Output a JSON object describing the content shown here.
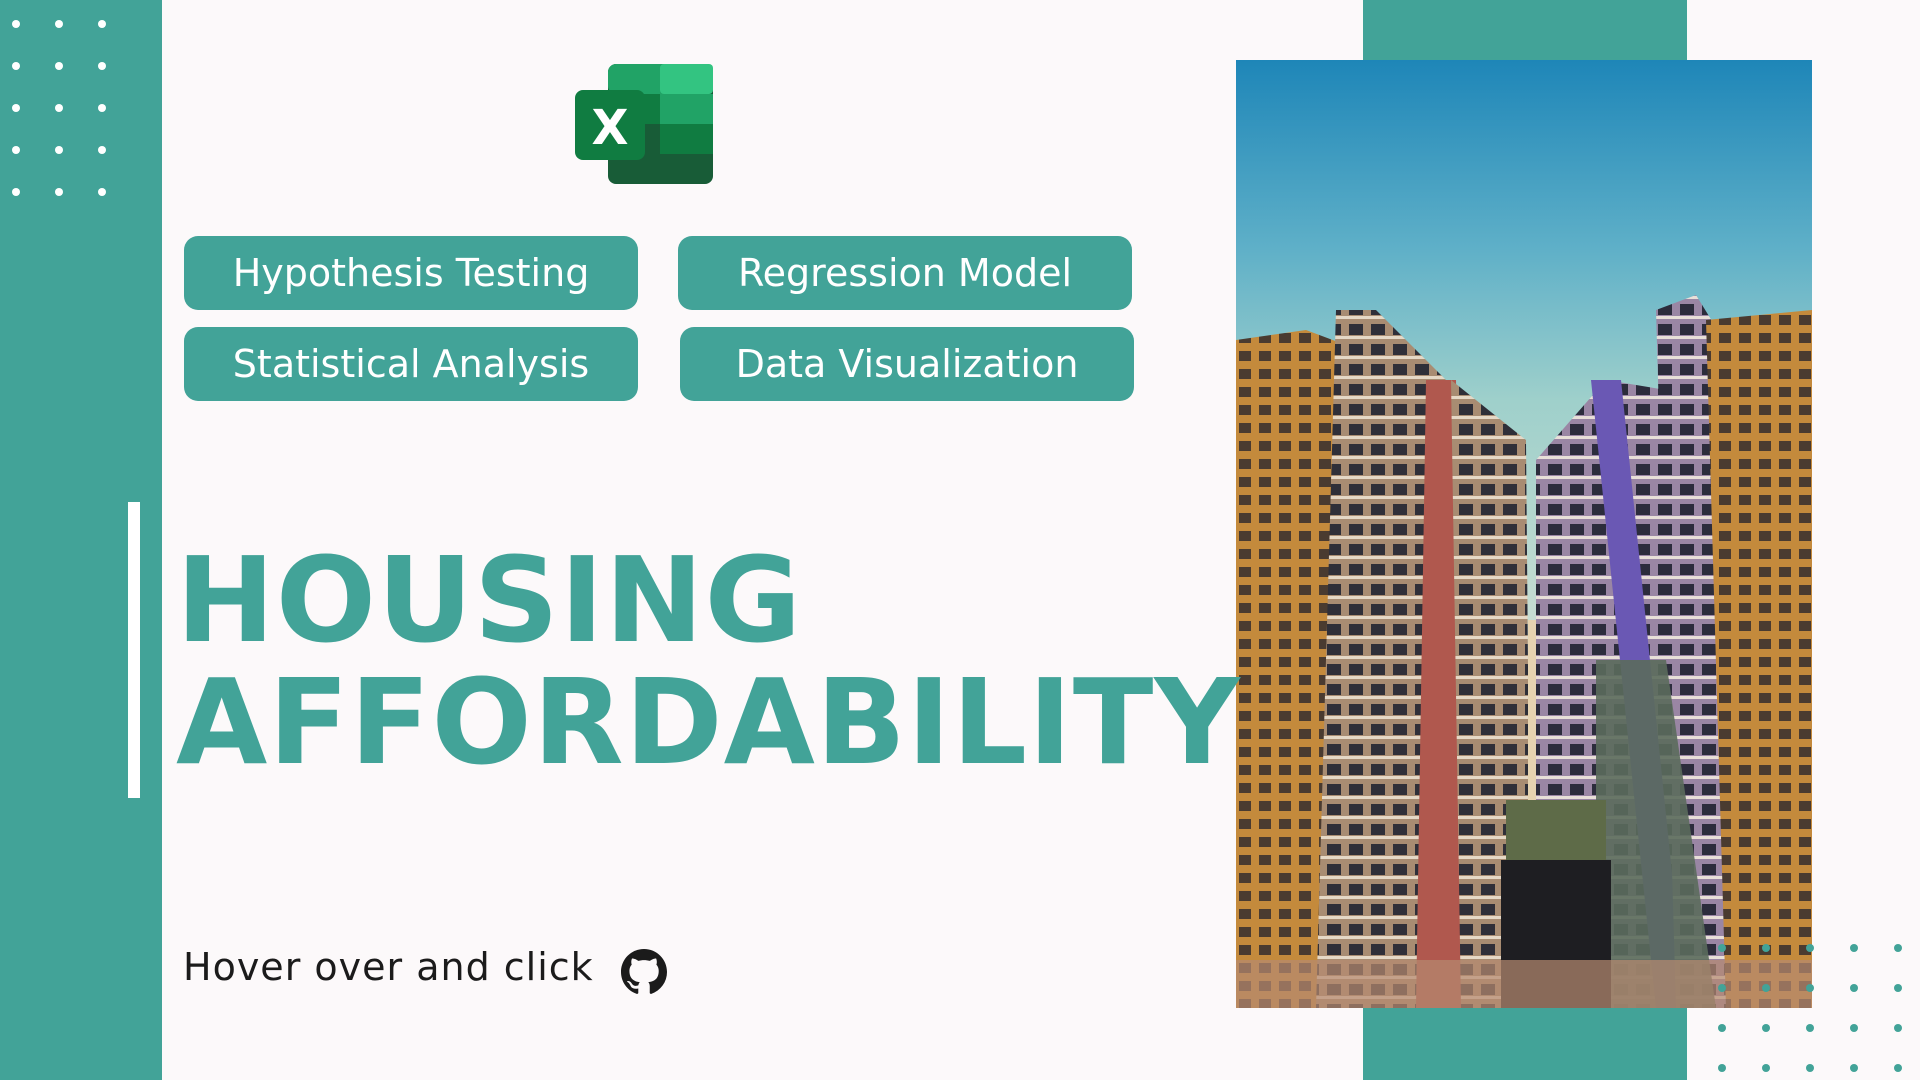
{
  "slide": {
    "title_line1": "HOUSING",
    "title_line2": "AFFORDABILITY",
    "tags": [
      {
        "label": "Hypothesis Testing"
      },
      {
        "label": "Regression Model"
      },
      {
        "label": "Statistical Analysis"
      },
      {
        "label": "Data Visualization"
      }
    ],
    "cta_text": "Hover over and click",
    "icons": {
      "app_logo": "excel-logo-icon",
      "link": "github-icon"
    },
    "colors": {
      "accent": "#42a398",
      "background": "#fcf9fa",
      "text": "#1b1b1b"
    }
  }
}
